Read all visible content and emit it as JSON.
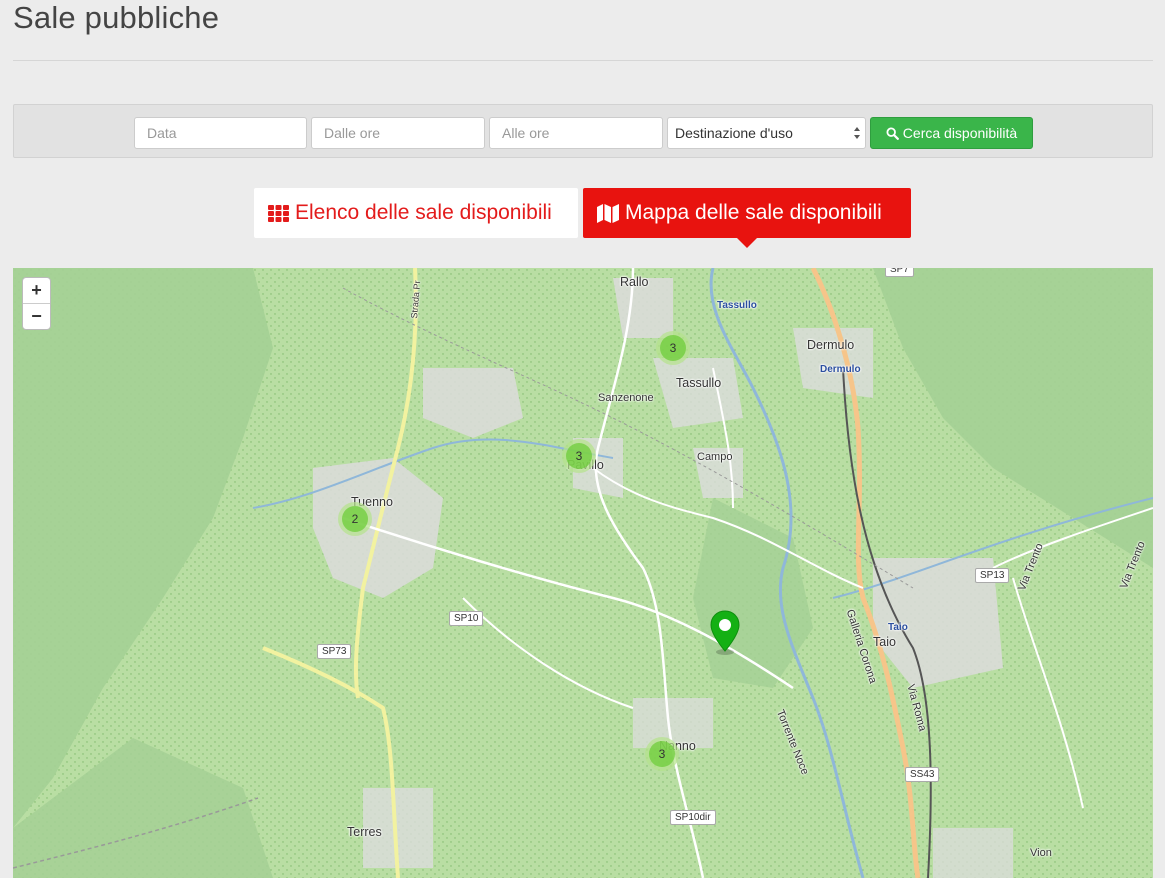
{
  "page": {
    "title": "Sale pubbliche"
  },
  "search": {
    "date_placeholder": "Data",
    "from_placeholder": "Dalle ore",
    "to_placeholder": "Alle ore",
    "usage_select": "Destinazione d'uso",
    "search_button": "Cerca disponibilità"
  },
  "tabs": {
    "list_label": "Elenco delle sale disponibili",
    "map_label": "Mappa delle sale disponibili"
  },
  "map": {
    "zoom_in": "+",
    "zoom_out": "−",
    "clusters": [
      "3",
      "3",
      "2",
      "3"
    ],
    "places": {
      "rallo": "Rallo",
      "tassullo_station": "Tassullo",
      "tassullo": "Tassullo",
      "sanzenone": "Sanzenone",
      "dermulo": "Dermulo",
      "dermulo_station": "Dermulo",
      "campo": "Campo",
      "pavillo": "Pavillo",
      "tuenno": "Tuenno",
      "taio": "Taio",
      "taio_station": "Taio",
      "terres": "Terres",
      "vion": "Vion",
      "torrente_noce": "Torrente Noce",
      "galleria_corona": "Galleria Corona",
      "via_roma": "Via Roma",
      "via_trento_1": "Via Trento",
      "via_trento_2": "Via Trento",
      "strada_pr": "Strada Pr",
      "nanno": "Nanno"
    },
    "roads": {
      "sp10": "SP10",
      "sp73": "SP73",
      "sp13": "SP13",
      "ss43": "SS43",
      "sp10dir": "SP10dir",
      "sp7": "SP7"
    }
  },
  "colors": {
    "accent_red": "#e8130f",
    "search_green": "#3ab54a",
    "marker_green": "#14b014",
    "map_base": "#b9dea3"
  }
}
